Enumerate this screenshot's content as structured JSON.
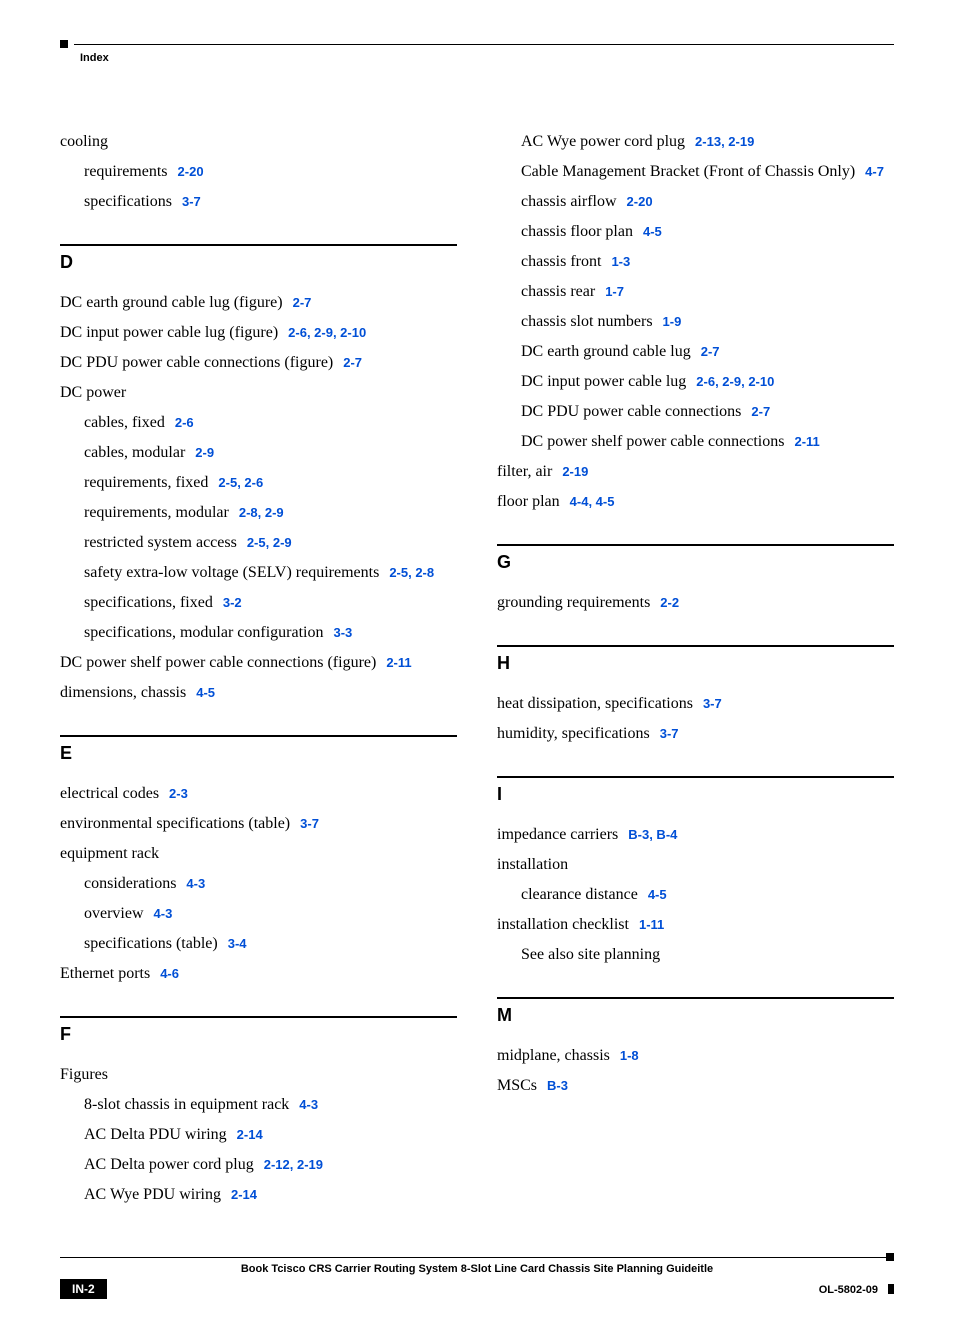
{
  "header": {
    "label": "Index"
  },
  "footer": {
    "title": "Book Tcisco CRS Carrier Routing System 8-Slot Line Card Chassis Site Planning Guideitle",
    "page": "IN-2",
    "doc_id": "OL-5802-09"
  },
  "left": {
    "pre": [
      {
        "text": "cooling",
        "sub": false,
        "ref": ""
      },
      {
        "text": "requirements",
        "sub": true,
        "ref": "2-20"
      },
      {
        "text": "specifications",
        "sub": true,
        "ref": "3-7"
      }
    ],
    "sections": [
      {
        "letter": "D",
        "entries": [
          {
            "text": "DC earth ground cable lug (figure)",
            "sub": false,
            "ref": "2-7"
          },
          {
            "text": "DC input power cable lug (figure)",
            "sub": false,
            "ref": "2-6, 2-9, 2-10"
          },
          {
            "text": "DC PDU power cable connections (figure)",
            "sub": false,
            "ref": "2-7"
          },
          {
            "text": "DC power",
            "sub": false,
            "ref": ""
          },
          {
            "text": "cables, fixed",
            "sub": true,
            "ref": "2-6"
          },
          {
            "text": "cables, modular",
            "sub": true,
            "ref": "2-9"
          },
          {
            "text": "requirements, fixed",
            "sub": true,
            "ref": "2-5, 2-6"
          },
          {
            "text": "requirements, modular",
            "sub": true,
            "ref": "2-8, 2-9"
          },
          {
            "text": "restricted system access",
            "sub": true,
            "ref": "2-5, 2-9"
          },
          {
            "text": "safety extra-low voltage (SELV) requirements",
            "sub": true,
            "ref": "2-5, 2-8"
          },
          {
            "text": "specifications, fixed",
            "sub": true,
            "ref": "3-2"
          },
          {
            "text": "specifications, modular configuration",
            "sub": true,
            "ref": "3-3"
          },
          {
            "text": "DC power shelf power cable connections (figure)",
            "sub": false,
            "ref": "2-11"
          },
          {
            "text": "dimensions, chassis",
            "sub": false,
            "ref": "4-5"
          }
        ]
      },
      {
        "letter": "E",
        "entries": [
          {
            "text": "electrical codes",
            "sub": false,
            "ref": "2-3"
          },
          {
            "text": "environmental specifications (table)",
            "sub": false,
            "ref": "3-7"
          },
          {
            "text": "equipment rack",
            "sub": false,
            "ref": ""
          },
          {
            "text": "considerations",
            "sub": true,
            "ref": "4-3"
          },
          {
            "text": "overview",
            "sub": true,
            "ref": "4-3"
          },
          {
            "text": "specifications (table)",
            "sub": true,
            "ref": "3-4"
          },
          {
            "text": "Ethernet ports",
            "sub": false,
            "ref": "4-6"
          }
        ]
      },
      {
        "letter": "F",
        "entries": [
          {
            "text": "Figures",
            "sub": false,
            "ref": ""
          },
          {
            "text": "8-slot chassis in equipment rack",
            "sub": true,
            "ref": "4-3"
          },
          {
            "text": "AC Delta PDU wiring",
            "sub": true,
            "ref": "2-14"
          },
          {
            "text": "AC Delta power cord plug",
            "sub": true,
            "ref": "2-12, 2-19"
          },
          {
            "text": "AC Wye PDU wiring",
            "sub": true,
            "ref": "2-14"
          }
        ]
      }
    ]
  },
  "right": {
    "pre": [
      {
        "text": "AC Wye power cord plug",
        "sub": true,
        "ref": "2-13, 2-19"
      },
      {
        "text": "Cable Management Bracket (Front of Chassis Only)",
        "sub": true,
        "ref": "4-7"
      },
      {
        "text": "chassis airflow",
        "sub": true,
        "ref": "2-20"
      },
      {
        "text": "chassis floor plan",
        "sub": true,
        "ref": "4-5"
      },
      {
        "text": "chassis front",
        "sub": true,
        "ref": "1-3"
      },
      {
        "text": "chassis rear",
        "sub": true,
        "ref": "1-7"
      },
      {
        "text": "chassis slot numbers",
        "sub": true,
        "ref": "1-9"
      },
      {
        "text": "DC earth ground cable lug",
        "sub": true,
        "ref": "2-7"
      },
      {
        "text": "DC input power cable lug",
        "sub": true,
        "ref": "2-6, 2-9, 2-10"
      },
      {
        "text": "DC PDU power cable connections",
        "sub": true,
        "ref": "2-7"
      },
      {
        "text": "DC power shelf power cable connections",
        "sub": true,
        "ref": "2-11"
      },
      {
        "text": "filter, air",
        "sub": false,
        "ref": "2-19"
      },
      {
        "text": "floor plan",
        "sub": false,
        "ref": "4-4, 4-5"
      }
    ],
    "sections": [
      {
        "letter": "G",
        "entries": [
          {
            "text": "grounding requirements",
            "sub": false,
            "ref": "2-2"
          }
        ]
      },
      {
        "letter": "H",
        "entries": [
          {
            "text": "heat dissipation, specifications",
            "sub": false,
            "ref": "3-7"
          },
          {
            "text": "humidity, specifications",
            "sub": false,
            "ref": "3-7"
          }
        ]
      },
      {
        "letter": "I",
        "entries": [
          {
            "text": "impedance carriers",
            "sub": false,
            "ref": "B-3, B-4"
          },
          {
            "text": "installation",
            "sub": false,
            "ref": ""
          },
          {
            "text": "clearance distance",
            "sub": true,
            "ref": "4-5"
          },
          {
            "text": "installation checklist",
            "sub": false,
            "ref": "1-11"
          },
          {
            "text": "See also site planning",
            "sub": true,
            "ref": ""
          }
        ]
      },
      {
        "letter": "M",
        "entries": [
          {
            "text": "midplane, chassis",
            "sub": false,
            "ref": "1-8"
          },
          {
            "text": "MSCs",
            "sub": false,
            "ref": "B-3"
          }
        ]
      }
    ]
  }
}
